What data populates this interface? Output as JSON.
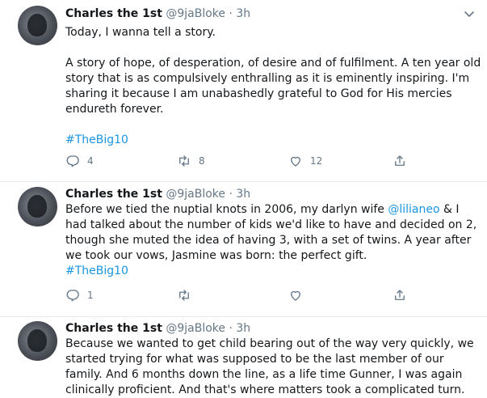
{
  "tweets": [
    {
      "name": "Charles the 1st",
      "handle": "@9jaBloke",
      "sep": "·",
      "time": "3h",
      "para1": "Today, I wanna tell a story.",
      "para2": "A story of hope, of desperation, of desire and of fulfilment. A ten year old story that is as compulsively enthralling as it is eminently inspiring. I'm sharing it because I am unabashedly grateful to God for His mercies endureth forever.",
      "hashtag": "#TheBig10",
      "replies": "4",
      "retweets": "8",
      "likes": "12"
    },
    {
      "name": "Charles the 1st",
      "handle": "@9jaBloke",
      "sep": "·",
      "time": "3h",
      "text_before": "Before we tied the nuptial knots in 2006, my darlyn wife ",
      "mention": "@lilianeo",
      "text_after": " & I had talked about the number of kids we'd like to have and decided on 2, though she muted the idea of having 3, with a set of twins. A year after we took our vows, Jasmine was born: the perfect gift.",
      "hashtag": "#TheBig10",
      "replies": "1",
      "retweets": "",
      "likes": ""
    },
    {
      "name": "Charles the 1st",
      "handle": "@9jaBloke",
      "sep": "·",
      "time": "3h",
      "text": "Because we wanted to get child bearing out of the way very quickly, we started trying for what was supposed to be the last member of our family. And 6 months down the line, as a life time Gunner, I was again clinically proficient. And that's where matters took a complicated turn."
    }
  ],
  "icons": {
    "chevron": "chevron-down-icon",
    "reply": "reply-icon",
    "retweet": "retweet-icon",
    "like": "heart-icon",
    "share": "share-icon"
  },
  "colors": {
    "link": "#1b95e0",
    "muted": "#657786",
    "text": "#14171a",
    "divider": "#e6ecf0"
  }
}
